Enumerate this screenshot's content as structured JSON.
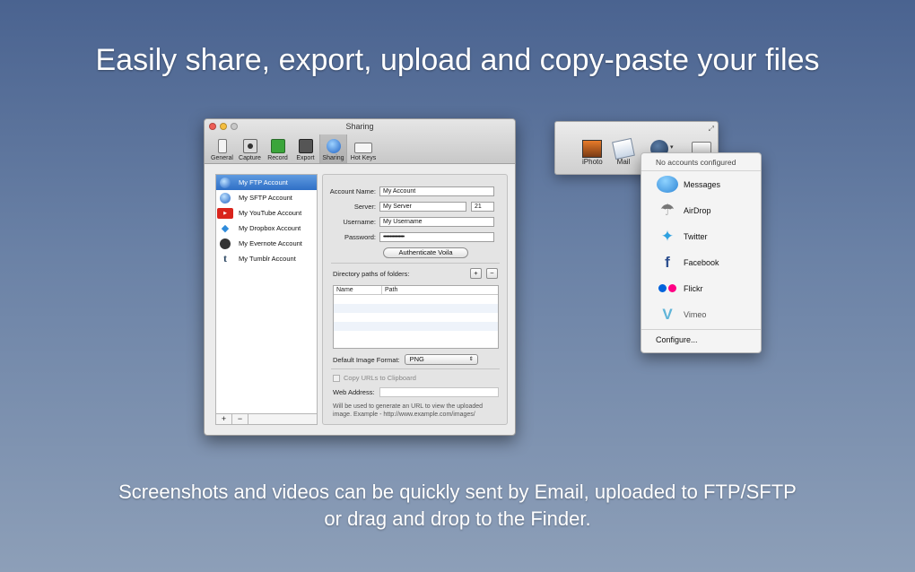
{
  "headline": "Easily share, export, upload and copy-paste your files",
  "caption": "Screenshots and videos can be quickly sent by Email, uploaded to FTP/SFTP or drag and drop to the Finder.",
  "window": {
    "title": "Sharing",
    "toolbar": [
      {
        "label": "General",
        "icon": "switch-icon"
      },
      {
        "label": "Capture",
        "icon": "camera-icon"
      },
      {
        "label": "Record",
        "icon": "video-camera-icon"
      },
      {
        "label": "Export",
        "icon": "export-icon"
      },
      {
        "label": "Sharing",
        "icon": "globe-icon"
      },
      {
        "label": "Hot Keys",
        "icon": "keyboard-icon"
      }
    ],
    "accounts": [
      {
        "label": "My FTP Account",
        "icon": "globe-icon",
        "selected": true
      },
      {
        "label": "My SFTP Account",
        "icon": "globe-icon"
      },
      {
        "label": "My YouTube Account",
        "icon": "youtube-icon"
      },
      {
        "label": "My Dropbox Account",
        "icon": "dropbox-icon"
      },
      {
        "label": "My Evernote Account",
        "icon": "evernote-icon"
      },
      {
        "label": "My Tumblr Account",
        "icon": "tumblr-icon"
      }
    ],
    "add_label": "+",
    "remove_label": "−",
    "form": {
      "account_name_label": "Account Name:",
      "account_name_value": "My Account",
      "server_label": "Server:",
      "server_value": "My Server",
      "port_value": "21",
      "username_label": "Username:",
      "username_value": "My Username",
      "password_label": "Password:",
      "password_value": "••••••••••••••••",
      "auth_button": "Authenticate Voila",
      "dir_label": "Directory paths of folders:",
      "dir_add": "+",
      "dir_remove": "−",
      "col_name": "Name",
      "col_path": "Path",
      "format_label": "Default Image Format:",
      "format_value": "PNG",
      "copy_urls_label": "Copy URLs to Clipboard",
      "web_address_label": "Web Address:",
      "web_address_value": "",
      "hint": "Will be used to generate an URL to view the uploaded image. Example - http://www.example.com/images/"
    }
  },
  "sharebar": {
    "items": [
      {
        "label": "iPhoto",
        "icon": "iphoto-icon"
      },
      {
        "label": "Mail",
        "icon": "mail-icon"
      }
    ]
  },
  "menu": {
    "header": "No accounts configured",
    "items": [
      {
        "label": "Messages",
        "icon": "messages-icon"
      },
      {
        "label": "AirDrop",
        "icon": "airdrop-icon"
      },
      {
        "label": "Twitter",
        "icon": "twitter-icon"
      },
      {
        "label": "Facebook",
        "icon": "facebook-icon"
      },
      {
        "label": "Flickr",
        "icon": "flickr-icon"
      },
      {
        "label": "Vimeo",
        "icon": "vimeo-icon",
        "disabled": true
      }
    ],
    "configure": "Configure..."
  },
  "colors": {
    "selection": "#2f6fc6",
    "twitter": "#2ea1e0",
    "facebook": "#2d4f8f",
    "flickr_pink": "#ff0084",
    "flickr_blue": "#0063dc",
    "vimeo": "#5fb4d8"
  }
}
